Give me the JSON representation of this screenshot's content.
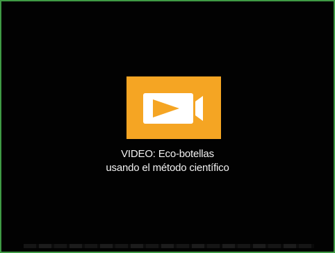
{
  "video": {
    "icon": "video-camera-icon",
    "accent_color": "#f5a523",
    "caption_line1": "VIDEO: Eco-botellas",
    "caption_line2": "usando el método científico"
  },
  "frame": {
    "border_color": "#3f9a45",
    "background": "#020202"
  }
}
